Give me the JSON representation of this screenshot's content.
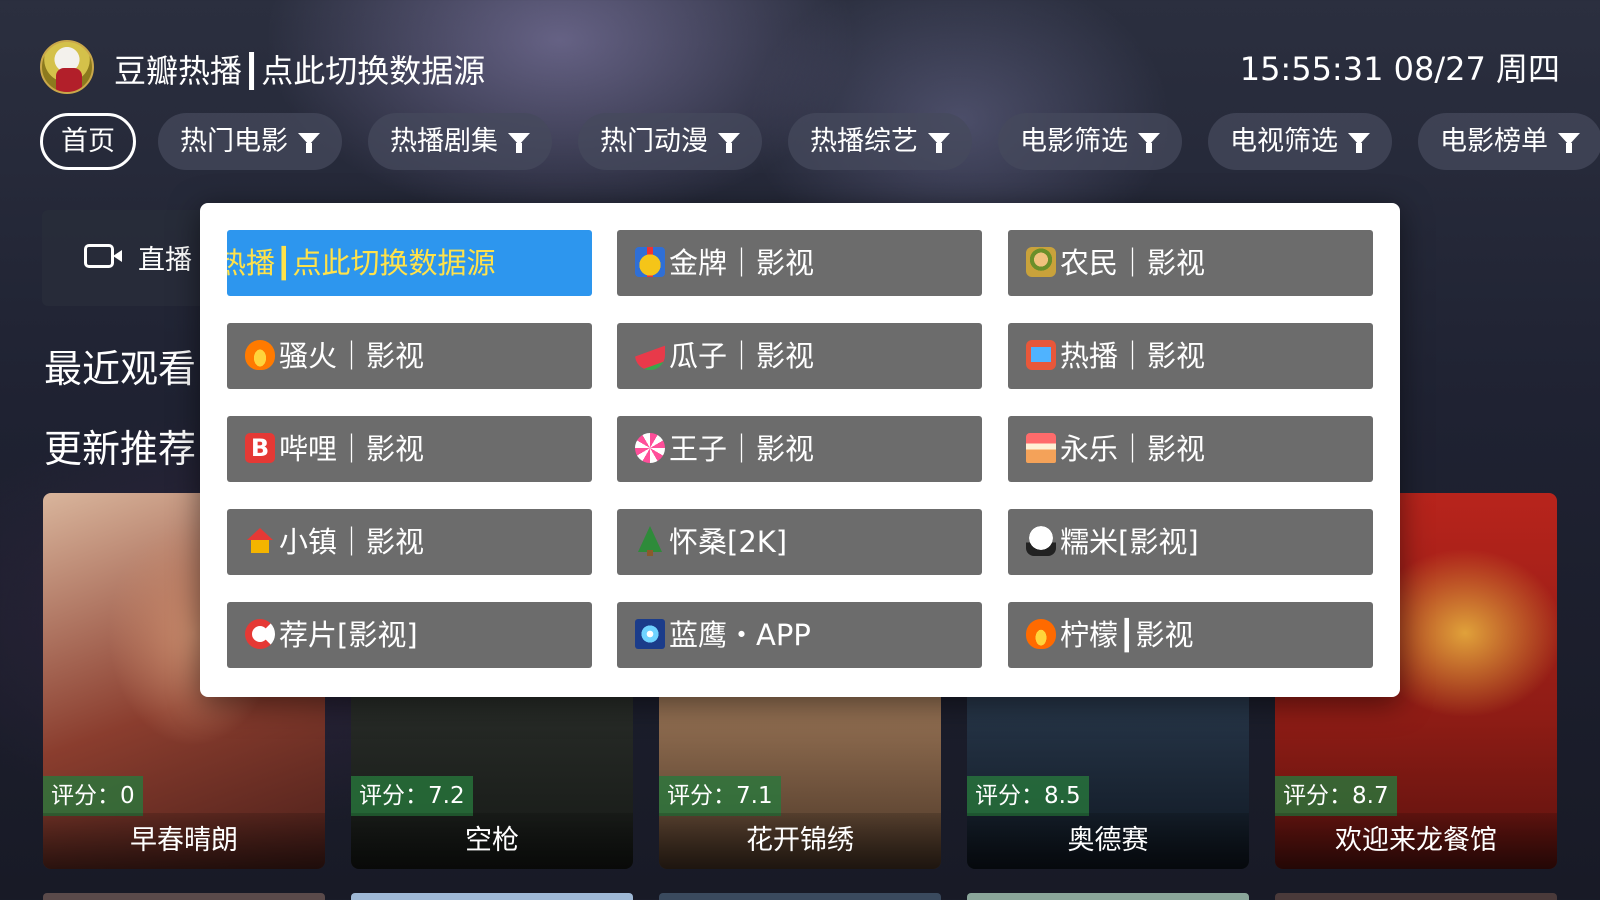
{
  "header": {
    "app_title": "豆瓣热播┃点此切换数据源",
    "clock": "15:55:31 08/27 周四"
  },
  "tabs": [
    {
      "label": "首页",
      "active": true,
      "filter": false
    },
    {
      "label": "热门电影",
      "active": false,
      "filter": true
    },
    {
      "label": "热播剧集",
      "active": false,
      "filter": true
    },
    {
      "label": "热门动漫",
      "active": false,
      "filter": true
    },
    {
      "label": "热播综艺",
      "active": false,
      "filter": true
    },
    {
      "label": "电影筛选",
      "active": false,
      "filter": true
    },
    {
      "label": "电视筛选",
      "active": false,
      "filter": true
    },
    {
      "label": "电影榜单",
      "active": false,
      "filter": true
    }
  ],
  "live": {
    "label": "直播",
    "icon": "video-camera-icon"
  },
  "sections": {
    "recent": "最近观看",
    "updates": "更新推荐"
  },
  "posters": [
    {
      "score": "评分：0",
      "title": "早春晴朗"
    },
    {
      "score": "评分：7.2",
      "title": "空枪"
    },
    {
      "score": "评分：7.1",
      "title": "花开锦绣"
    },
    {
      "score": "评分：8.5",
      "title": "奥德赛"
    },
    {
      "score": "评分：8.7",
      "title": "欢迎来龙餐馆"
    }
  ],
  "sources": [
    {
      "label": "热播┃点此切换数据源",
      "icon": "",
      "selected": true
    },
    {
      "label": "金牌｜影视",
      "icon": "medal-icon",
      "selected": false
    },
    {
      "label": "农民｜影视",
      "icon": "farmer-icon",
      "selected": false
    },
    {
      "label": "骚火｜影视",
      "icon": "fire-icon",
      "selected": false
    },
    {
      "label": "瓜子｜影视",
      "icon": "watermelon-icon",
      "selected": false
    },
    {
      "label": "热播｜影视",
      "icon": "tv-icon",
      "selected": false
    },
    {
      "label": "哔哩｜影视",
      "icon": "bilibili-b-icon",
      "selected": false
    },
    {
      "label": "王子｜影视",
      "icon": "lollipop-icon",
      "selected": false
    },
    {
      "label": "永乐｜影视",
      "icon": "cake-icon",
      "selected": false
    },
    {
      "label": "小镇｜影视",
      "icon": "house-icon",
      "selected": false
    },
    {
      "label": "怀桑[2K]",
      "icon": "christmas-tree-icon",
      "selected": false
    },
    {
      "label": "糯米[影视]",
      "icon": "rice-ball-icon",
      "selected": false
    },
    {
      "label": "荐片[影视]",
      "icon": "magnet-icon",
      "selected": false
    },
    {
      "label": "蓝鹰・APP",
      "icon": "sparkler-icon",
      "selected": false
    },
    {
      "label": "柠檬┃影视",
      "icon": "fire-icon",
      "selected": false
    }
  ],
  "colors": {
    "selected_source_bg": "#2d96ee",
    "selected_source_text": "#ffe24a",
    "source_bg": "#6c6c6c",
    "score_bg": "#287a3c"
  }
}
